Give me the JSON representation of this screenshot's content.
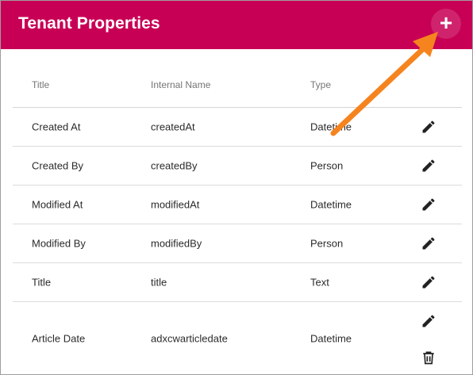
{
  "header": {
    "title": "Tenant Properties",
    "add_label": "+"
  },
  "table": {
    "columns": [
      "Title",
      "Internal Name",
      "Type"
    ],
    "rows": [
      {
        "title": "Created At",
        "internal_name": "createdAt",
        "type": "Datetime"
      },
      {
        "title": "Created By",
        "internal_name": "createdBy",
        "type": "Person"
      },
      {
        "title": "Modified At",
        "internal_name": "modifiedAt",
        "type": "Datetime"
      },
      {
        "title": "Modified By",
        "internal_name": "modifiedBy",
        "type": "Person"
      },
      {
        "title": "Title",
        "internal_name": "title",
        "type": "Text"
      },
      {
        "title": "Article Date",
        "internal_name": "adxcwarticledate",
        "type": "Datetime"
      }
    ]
  },
  "icons": {
    "edit": "pencil-icon",
    "delete": "trash-icon",
    "add": "plus-icon"
  },
  "colors": {
    "header_bg": "#c80055",
    "annotation_arrow": "#f5841f"
  }
}
